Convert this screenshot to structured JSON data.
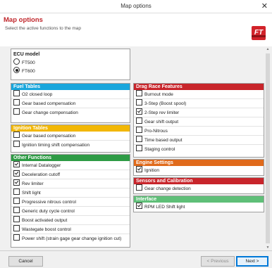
{
  "window": {
    "title": "Map options",
    "close_glyph": "✕"
  },
  "header": {
    "title": "Map options",
    "subtitle": "Select the active functions to the map",
    "logo": "FT"
  },
  "ecu": {
    "title": "ECU model",
    "options": [
      {
        "label": "FT500",
        "checked": false
      },
      {
        "label": "FT600",
        "checked": true
      }
    ]
  },
  "colors": {
    "fuel": "#19a6dc",
    "ignition": "#f2b705",
    "other": "#2e9b45",
    "drag": "#c8252b",
    "engine": "#e06a1b",
    "sensors": "#c8252b",
    "interface": "#2e9b45"
  },
  "fuel_tables": {
    "title": "Fuel Tables",
    "items": [
      {
        "label": "O2 closed loop",
        "checked": false
      },
      {
        "label": "Gear based compensation",
        "checked": false
      },
      {
        "label": "Gear change compensation",
        "checked": false
      }
    ]
  },
  "ignition_tables": {
    "title": "Ignition Tables",
    "items": [
      {
        "label": "Gear based compensation",
        "checked": false
      },
      {
        "label": "Ignition timing shift compensation",
        "checked": false
      }
    ]
  },
  "other_functions": {
    "title": "Other Functions",
    "items": [
      {
        "label": "Internal Datalogger",
        "checked": true
      },
      {
        "label": "Deceleration cutoff",
        "checked": true
      },
      {
        "label": "Rev limiter",
        "checked": true
      },
      {
        "label": "Shift light",
        "checked": false
      },
      {
        "label": "Progressive nitrous control",
        "checked": false
      },
      {
        "label": "Generic duty cycle control",
        "checked": false
      },
      {
        "label": "Boost activated output",
        "checked": false
      },
      {
        "label": "Wastegate boost control",
        "checked": false
      },
      {
        "label": "Power shift (strain gage gear change ignition cut)",
        "checked": false
      }
    ]
  },
  "drag_race": {
    "title": "Drag Race Features",
    "items": [
      {
        "label": "Burnout mode",
        "checked": false
      },
      {
        "label": "3-Step (Boost spool)",
        "checked": false
      },
      {
        "label": "2-Step rev limiter",
        "checked": true
      },
      {
        "label": "Gear shift output",
        "checked": false
      },
      {
        "label": "Pro-Nitrous",
        "checked": false
      },
      {
        "label": "Time based output",
        "checked": false
      },
      {
        "label": "Staging control",
        "checked": false
      }
    ]
  },
  "engine_settings": {
    "title": "Engine Settings",
    "items": [
      {
        "label": "Ignition",
        "checked": true
      }
    ]
  },
  "sensors": {
    "title": "Sensors and Calibration",
    "items": [
      {
        "label": "Gear change detection",
        "checked": false
      }
    ]
  },
  "interface": {
    "title": "Interface",
    "items": [
      {
        "label": "RPM LED Shift light",
        "checked": true
      }
    ]
  },
  "footer": {
    "cancel": "Cancel",
    "previous": "< Previous",
    "next": "Next >"
  }
}
